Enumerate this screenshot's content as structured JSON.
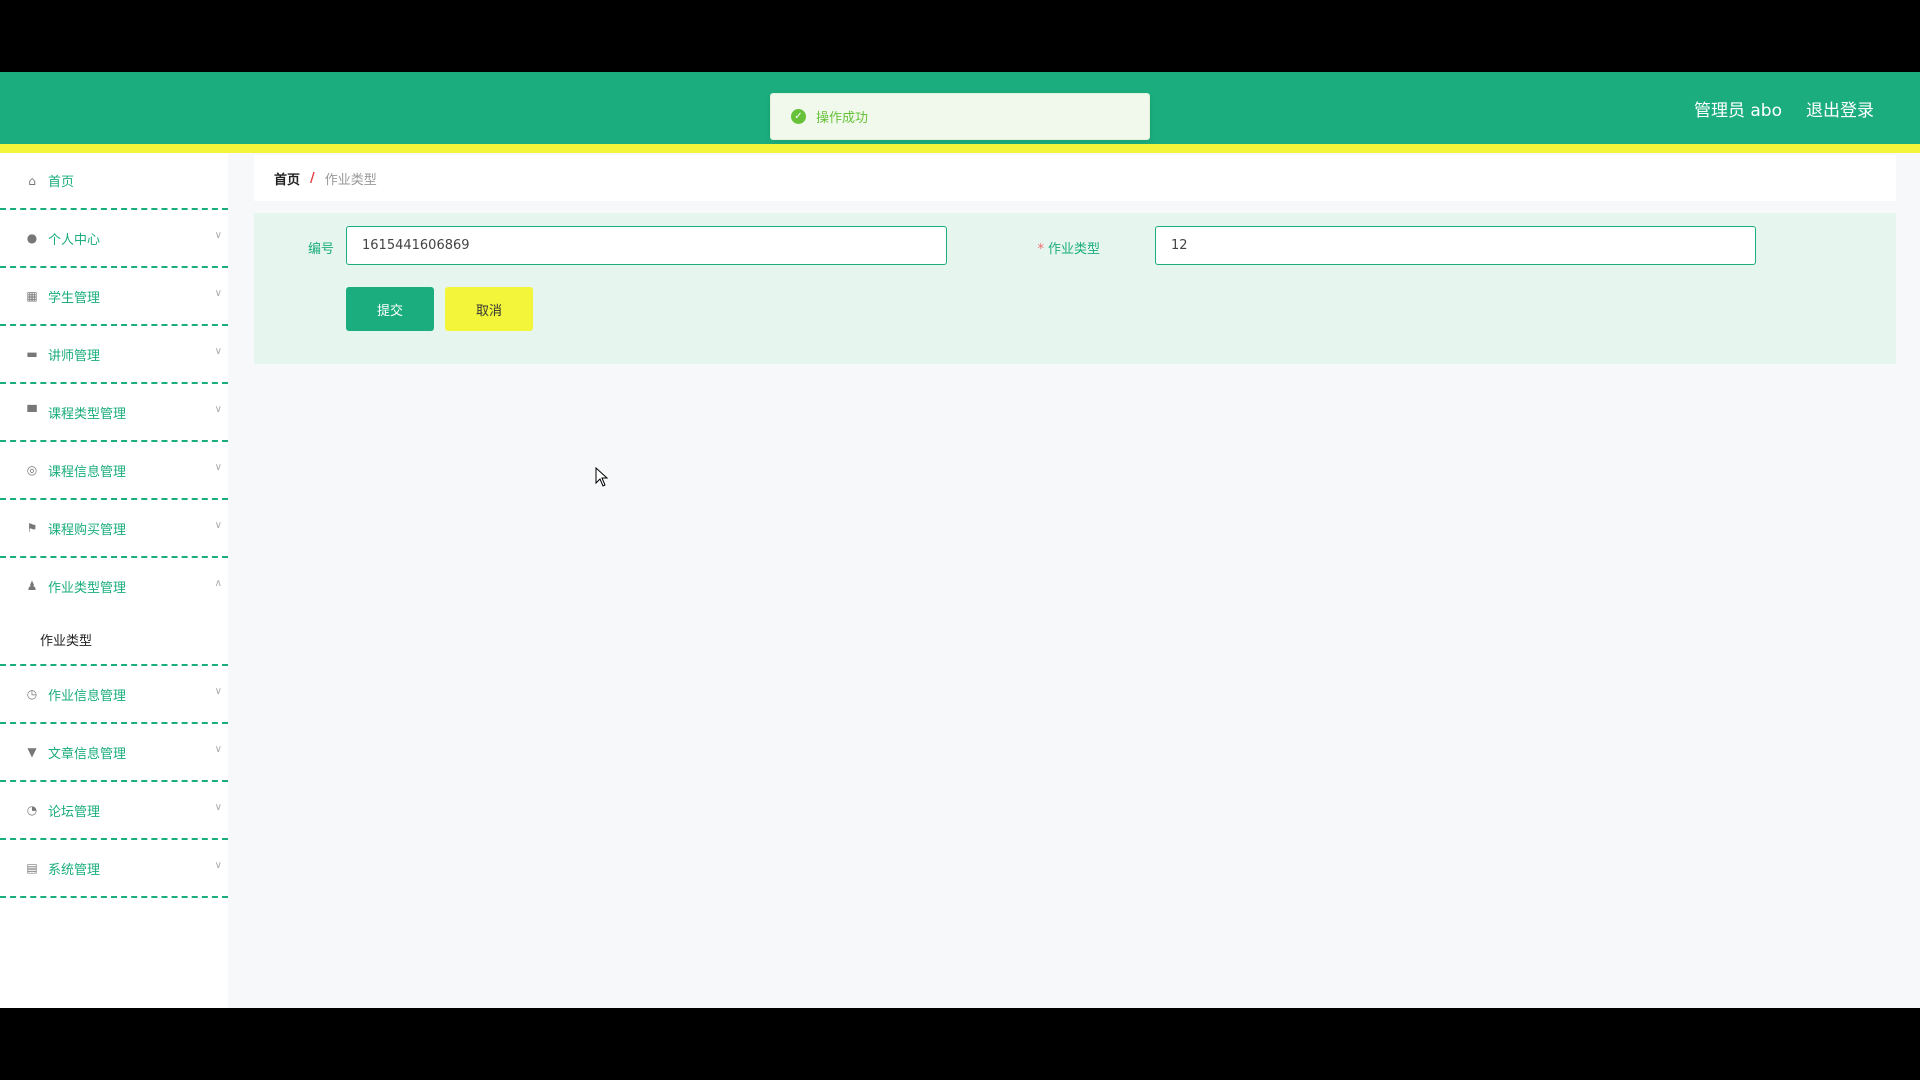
{
  "header": {
    "user_label": "管理员 abo",
    "logout_label": "退出登录",
    "bg_color": "#1bad7d",
    "stripe_color": "#f2f53a"
  },
  "toast": {
    "message": "操作成功",
    "icon": "check-circle-icon"
  },
  "sidebar": {
    "items": [
      {
        "label": "首页",
        "icon": "home-icon"
      },
      {
        "label": "个人中心",
        "icon": "user-icon"
      },
      {
        "label": "学生管理",
        "icon": "grid-icon"
      },
      {
        "label": "讲师管理",
        "icon": "briefcase-icon"
      },
      {
        "label": "课程类型管理",
        "icon": "monitor-icon"
      },
      {
        "label": "课程信息管理",
        "icon": "aperture-icon"
      },
      {
        "label": "课程购买管理",
        "icon": "flag-icon"
      },
      {
        "label": "作业类型管理",
        "icon": "person-icon"
      },
      {
        "label": "作业信息管理",
        "icon": "clock-icon"
      },
      {
        "label": "文章信息管理",
        "icon": "sign-icon"
      },
      {
        "label": "论坛管理",
        "icon": "compass-icon"
      },
      {
        "label": "系统管理",
        "icon": "clipboard-icon"
      }
    ],
    "submenu_label": "作业类型"
  },
  "breadcrumb": {
    "home": "首页",
    "separator": "/",
    "current": "作业类型"
  },
  "form": {
    "id_label": "编号",
    "id_value": "1615441606869",
    "type_label": "作业类型",
    "required_mark": "*",
    "type_value": "12",
    "submit_label": "提交",
    "cancel_label": "取消"
  }
}
